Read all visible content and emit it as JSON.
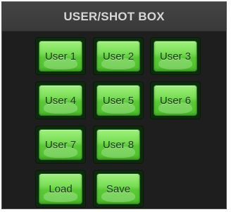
{
  "panel": {
    "title": "USER/SHOT BOX"
  },
  "buttons": {
    "user1": "User 1",
    "user2": "User 2",
    "user3": "User 3",
    "user4": "User 4",
    "user5": "User 5",
    "user6": "User 6",
    "user7": "User 7",
    "user8": "User 8",
    "load": "Load",
    "save": "Save"
  },
  "colors": {
    "panel_background": "#1e1e1e",
    "title_bar": "#444444",
    "button_green": "#79de54",
    "button_text": "#1d3a12",
    "title_text": "#d6d6d6"
  }
}
